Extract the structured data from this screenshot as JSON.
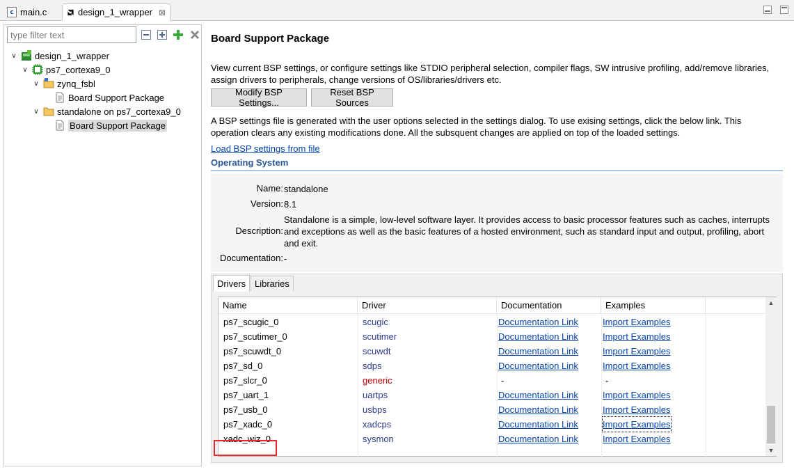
{
  "tabs": [
    {
      "label": "main.c",
      "icon": "c-file-icon",
      "active": false
    },
    {
      "label": "design_1_wrapper",
      "icon": "amd-logo-icon",
      "active": true,
      "close": "⊠"
    }
  ],
  "filter": {
    "placeholder": "type filter text"
  },
  "tree": [
    {
      "label": "design_1_wrapper",
      "icon": "platform-icon",
      "expanded": true
    },
    {
      "label": "ps7_cortexa9_0",
      "icon": "processor-icon",
      "expanded": true
    },
    {
      "label": "zynq_fsbl",
      "icon": "domain-folder-icon",
      "expanded": true
    },
    {
      "label": "Board Support Package",
      "icon": "document-icon"
    },
    {
      "label": "standalone on ps7_cortexa9_0",
      "icon": "domain-folder-icon",
      "expanded": true
    },
    {
      "label": "Board Support Package",
      "icon": "document-icon",
      "selected": true
    }
  ],
  "main": {
    "title": "Board Support Package",
    "intro_line1": "View current BSP settings, or configure settings like STDIO peripheral selection, compiler flags, SW intrusive profiling, add/remove libraries,",
    "intro_line2": "assign drivers to peripherals, change versions of OS/libraries/drivers etc.",
    "modify_button": "Modify BSP Settings...",
    "reset_button": "Reset BSP Sources",
    "note_line1": "A BSP settings file is generated with the user options selected in the settings dialog. To use exising settings, click the below link. This",
    "note_line2": "operation clears any existing modifications done. All the subsquent changes are applied on top of the loaded settings.",
    "load_link": "Load BSP settings from file"
  },
  "os": {
    "section_title": "Operating System",
    "name_label": "Name:",
    "name_value": "standalone",
    "version_label": "Version:",
    "version_value": "8.1",
    "description_label": "Description:",
    "description_line1": "Standalone is a simple, low-level software layer. It provides access to basic processor features such as caches, interrupts",
    "description_line2": "and exceptions as well as the basic features of a hosted environment, such as standard input and output, profiling, abort",
    "description_line3": "and exit.",
    "documentation_label": "Documentation:",
    "documentation_value": "-"
  },
  "drivers_tabs": {
    "drivers": "Drivers",
    "libraries": "Libraries"
  },
  "table": {
    "headers": [
      "Name",
      "Driver",
      "Documentation",
      "Examples"
    ],
    "rows": [
      {
        "name": "ps7_scugic_0",
        "driver": "scugic",
        "doc": "Documentation Link",
        "ex": "Import Examples"
      },
      {
        "name": "ps7_scutimer_0",
        "driver": "scutimer",
        "doc": "Documentation Link",
        "ex": "Import Examples"
      },
      {
        "name": "ps7_scuwdt_0",
        "driver": "scuwdt",
        "doc": "Documentation Link",
        "ex": "Import Examples"
      },
      {
        "name": "ps7_sd_0",
        "driver": "sdps",
        "doc": "Documentation Link",
        "ex": "Import Examples"
      },
      {
        "name": "ps7_slcr_0",
        "driver": "generic",
        "doc": "-",
        "ex": "-"
      },
      {
        "name": "ps7_uart_1",
        "driver": "uartps",
        "doc": "Documentation Link",
        "ex": "Import Examples"
      },
      {
        "name": "ps7_usb_0",
        "driver": "usbps",
        "doc": "Documentation Link",
        "ex": "Import Examples"
      },
      {
        "name": "ps7_xadc_0",
        "driver": "xadcps",
        "doc": "Documentation Link",
        "ex": "Import Examples"
      },
      {
        "name": "xadc_wiz_0",
        "driver": "sysmon",
        "doc": "Documentation Link",
        "ex": "Import Examples"
      }
    ]
  },
  "colors": {
    "link": "#0645ad",
    "driver": "#2e3a8c",
    "generic_driver": "#c00000",
    "highlight": "#e8262b",
    "section_title": "#2b5797"
  }
}
